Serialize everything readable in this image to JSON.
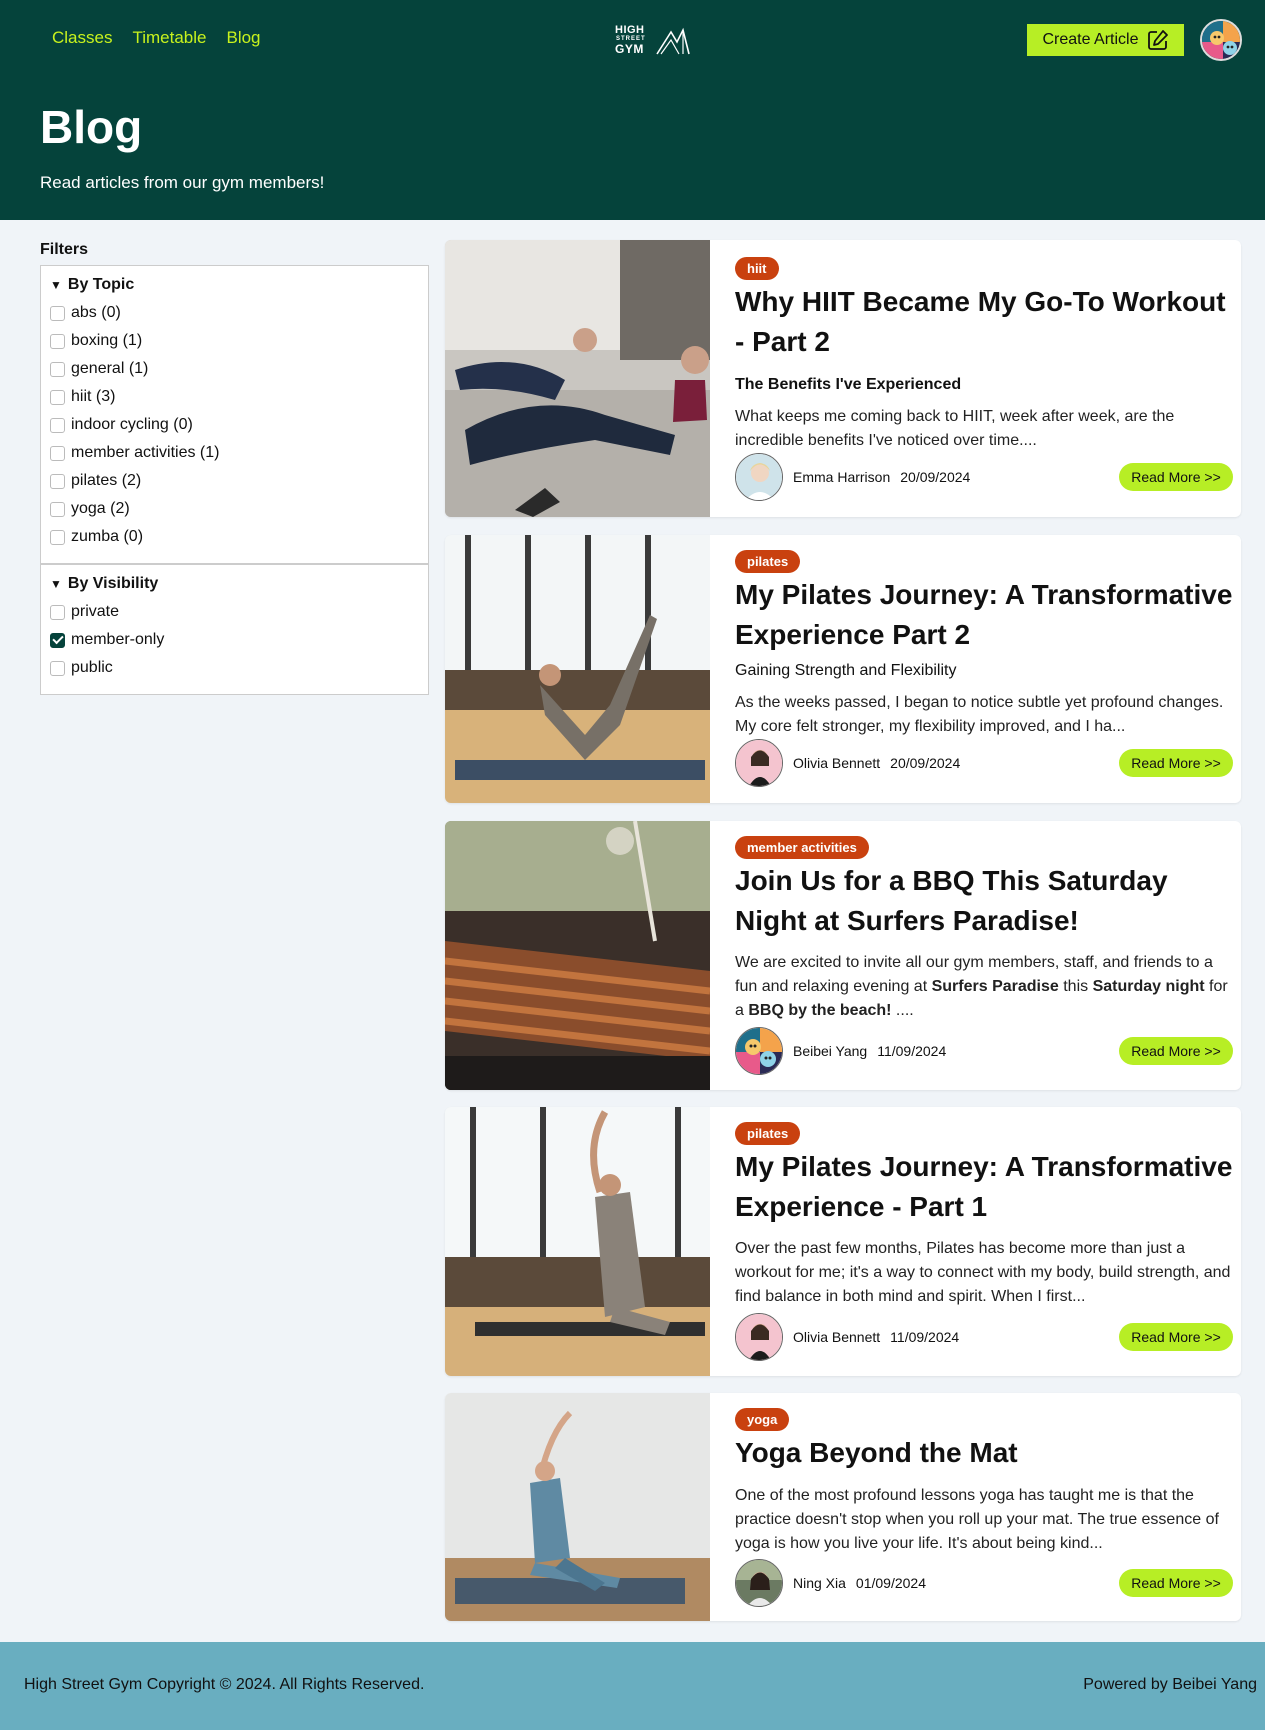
{
  "nav": {
    "classes": "Classes",
    "timetable": "Timetable",
    "blog": "Blog"
  },
  "logo": {
    "line1": "HIGH",
    "line2": "STREET",
    "line3": "GYM"
  },
  "header": {
    "create_label": "Create Article",
    "title": "Blog",
    "subtitle": "Read articles from our gym members!"
  },
  "filters": {
    "label": "Filters",
    "topic_title": "By Topic",
    "topics": [
      {
        "label": "abs (0)",
        "checked": false
      },
      {
        "label": "boxing (1)",
        "checked": false
      },
      {
        "label": "general (1)",
        "checked": false
      },
      {
        "label": "hiit (3)",
        "checked": false
      },
      {
        "label": "indoor cycling (0)",
        "checked": false
      },
      {
        "label": "member activities (1)",
        "checked": false
      },
      {
        "label": "pilates (2)",
        "checked": false
      },
      {
        "label": "yoga (2)",
        "checked": false
      },
      {
        "label": "zumba (0)",
        "checked": false
      }
    ],
    "visibility_title": "By Visibility",
    "visibility": [
      {
        "label": "private",
        "checked": false
      },
      {
        "label": "member-only",
        "checked": true
      },
      {
        "label": "public",
        "checked": false
      }
    ]
  },
  "articles": [
    {
      "tag": "hiit",
      "title": "Why HIIT Became My Go-To Workout - Part 2",
      "subtitle": "The Benefits I've Experienced",
      "excerpt": "What keeps me coming back to HIIT, week after week, are the incredible benefits I've noticed over time....",
      "author": "Emma Harrison",
      "date": "20/09/2024",
      "read_more": "Read More >>"
    },
    {
      "tag": "pilates",
      "title": "My Pilates Journey: A Transformative Experience Part 2",
      "subtitle": "Gaining Strength and Flexibility",
      "excerpt": "As the weeks passed, I began to notice subtle yet profound changes. My core felt stronger, my flexibility improved, and I ha...",
      "author": "Olivia Bennett",
      "date": "20/09/2024",
      "read_more": "Read More >>"
    },
    {
      "tag": "member activities",
      "title": "Join Us for a BBQ This Saturday Night at Surfers Paradise!",
      "excerpt_parts": {
        "p1": "We are excited to invite all our gym members, staff, and friends to a fun and relaxing evening at ",
        "b1": "Surfers Paradise",
        "p2": " this ",
        "b2": "Saturday night",
        "p3": " for a ",
        "b3": "BBQ by the beach!",
        "p4": " ...."
      },
      "author": "Beibei Yang",
      "date": "11/09/2024",
      "read_more": "Read More >>"
    },
    {
      "tag": "pilates",
      "title": "My Pilates Journey: A Transformative Experience - Part 1",
      "excerpt": "Over the past few months, Pilates has become more than just a workout for me; it's a way to connect with my body, build strength, and find balance in both mind and spirit. When I first...",
      "author": "Olivia Bennett",
      "date": "11/09/2024",
      "read_more": "Read More >>"
    },
    {
      "tag": "yoga",
      "title": "Yoga Beyond the Mat",
      "excerpt": "One of the most profound lessons yoga has taught me is that the practice doesn't stop when you roll up your mat. The true essence of yoga is how you live your life. It's about being kind...",
      "author": "Ning Xia",
      "date": "01/09/2024",
      "read_more": "Read More >>"
    }
  ],
  "footer": {
    "copyright": "High Street Gym Copyright © 2024. All Rights Reserved.",
    "powered": "Powered by Beibei Yang"
  },
  "colors": {
    "header_bg": "#05433b",
    "accent": "#b7ee25",
    "tag": "#c9410f",
    "footer_bg": "#69aec0"
  }
}
